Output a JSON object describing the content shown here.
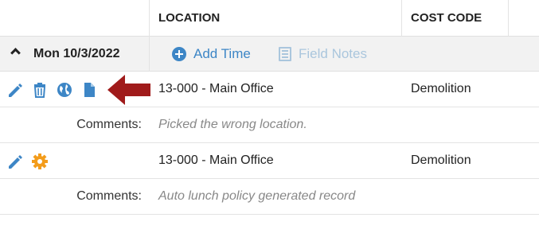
{
  "header": {
    "location_label": "LOCATION",
    "cost_code_label": "COST CODE"
  },
  "day_group": {
    "date_label": "Mon 10/3/2022",
    "add_time_label": "Add Time",
    "field_notes_label": "Field Notes"
  },
  "entries": [
    {
      "location": "13-000 - Main Office",
      "cost_code": "Demolition",
      "comments_label": "Comments:",
      "comment": "Picked the wrong location.",
      "icons": [
        "pencil-icon",
        "trash-icon",
        "globe-icon",
        "document-icon"
      ]
    },
    {
      "location": "13-000 - Main Office",
      "cost_code": "Demolition",
      "comments_label": "Comments:",
      "comment": "Auto lunch policy generated record",
      "icons": [
        "pencil-icon",
        "gear-icon"
      ]
    }
  ],
  "colors": {
    "accent_blue": "#3d86c6",
    "disabled_blue": "#aac6dd",
    "gear_orange": "#f39c1b",
    "arrow_red": "#a01b1b",
    "group_bg": "#f2f2f2"
  }
}
